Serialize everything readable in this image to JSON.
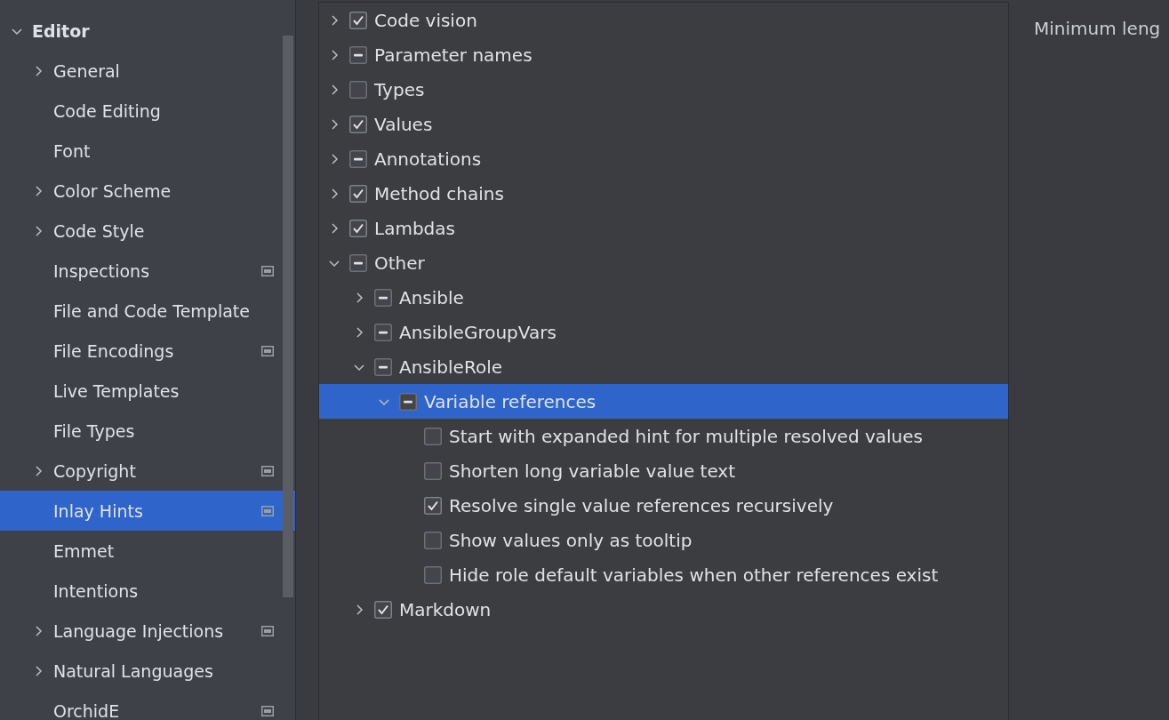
{
  "sidebar": {
    "items": [
      {
        "label": "Editor",
        "bold": true,
        "has_children": true,
        "expanded": true,
        "selected": false,
        "project_scope": false,
        "children": [
          {
            "label": "General",
            "expanded": false,
            "has_children": true,
            "selected": false,
            "project_scope": false
          },
          {
            "label": "Code Editing",
            "selected": false,
            "project_scope": false
          },
          {
            "label": "Font",
            "selected": false,
            "project_scope": false
          },
          {
            "label": "Color Scheme",
            "expanded": false,
            "has_children": true,
            "selected": false,
            "project_scope": false
          },
          {
            "label": "Code Style",
            "expanded": false,
            "has_children": true,
            "selected": false,
            "project_scope": false
          },
          {
            "label": "Inspections",
            "selected": false,
            "project_scope": true
          },
          {
            "label": "File and Code Template",
            "selected": false,
            "project_scope": false
          },
          {
            "label": "File Encodings",
            "selected": false,
            "project_scope": true
          },
          {
            "label": "Live Templates",
            "selected": false,
            "project_scope": false
          },
          {
            "label": "File Types",
            "selected": false,
            "project_scope": false
          },
          {
            "label": "Copyright",
            "expanded": false,
            "has_children": true,
            "selected": false,
            "project_scope": true
          },
          {
            "label": "Inlay Hints",
            "selected": true,
            "project_scope": true
          },
          {
            "label": "Emmet",
            "selected": false,
            "project_scope": false
          },
          {
            "label": "Intentions",
            "selected": false,
            "project_scope": false
          },
          {
            "label": "Language Injections",
            "expanded": false,
            "has_children": true,
            "selected": false,
            "project_scope": true
          },
          {
            "label": "Natural Languages",
            "expanded": false,
            "has_children": true,
            "selected": false,
            "project_scope": false
          },
          {
            "label": "OrchidE",
            "selected": false,
            "project_scope": true
          }
        ]
      }
    ]
  },
  "hints_tree": [
    {
      "label": "Code vision",
      "checked": true,
      "mixed": false,
      "has_children": true,
      "expanded": false,
      "selected": false
    },
    {
      "label": "Parameter names",
      "checked": false,
      "mixed": true,
      "has_children": true,
      "expanded": false,
      "selected": false
    },
    {
      "label": "Types",
      "checked": false,
      "mixed": false,
      "has_children": true,
      "expanded": false,
      "selected": false
    },
    {
      "label": "Values",
      "checked": true,
      "mixed": false,
      "has_children": true,
      "expanded": false,
      "selected": false
    },
    {
      "label": "Annotations",
      "checked": false,
      "mixed": true,
      "has_children": true,
      "expanded": false,
      "selected": false
    },
    {
      "label": "Method chains",
      "checked": true,
      "mixed": false,
      "has_children": true,
      "expanded": false,
      "selected": false
    },
    {
      "label": "Lambdas",
      "checked": true,
      "mixed": false,
      "has_children": true,
      "expanded": false,
      "selected": false
    },
    {
      "label": "Other",
      "checked": false,
      "mixed": true,
      "has_children": true,
      "expanded": true,
      "selected": false,
      "children": [
        {
          "label": "Ansible",
          "checked": false,
          "mixed": true,
          "has_children": true,
          "expanded": false,
          "selected": false
        },
        {
          "label": "AnsibleGroupVars",
          "checked": false,
          "mixed": true,
          "has_children": true,
          "expanded": false,
          "selected": false
        },
        {
          "label": "AnsibleRole",
          "checked": false,
          "mixed": true,
          "has_children": true,
          "expanded": true,
          "selected": false,
          "children": [
            {
              "label": "Variable references",
              "checked": false,
              "mixed": true,
              "has_children": true,
              "expanded": true,
              "selected": true,
              "children": [
                {
                  "label": "Start with expanded hint for multiple resolved values",
                  "checked": false,
                  "mixed": false,
                  "selected": false
                },
                {
                  "label": "Shorten long variable value text",
                  "checked": false,
                  "mixed": false,
                  "selected": false
                },
                {
                  "label": "Resolve single value references recursively",
                  "checked": true,
                  "mixed": false,
                  "selected": false
                },
                {
                  "label": "Show values only as tooltip",
                  "checked": false,
                  "mixed": false,
                  "selected": false
                },
                {
                  "label": "Hide role default variables when other references exist",
                  "checked": false,
                  "mixed": false,
                  "selected": false
                }
              ]
            }
          ]
        },
        {
          "label": "Markdown",
          "checked": true,
          "mixed": false,
          "has_children": true,
          "expanded": false,
          "selected": false
        }
      ]
    }
  ],
  "details": {
    "label": "Minimum leng"
  }
}
